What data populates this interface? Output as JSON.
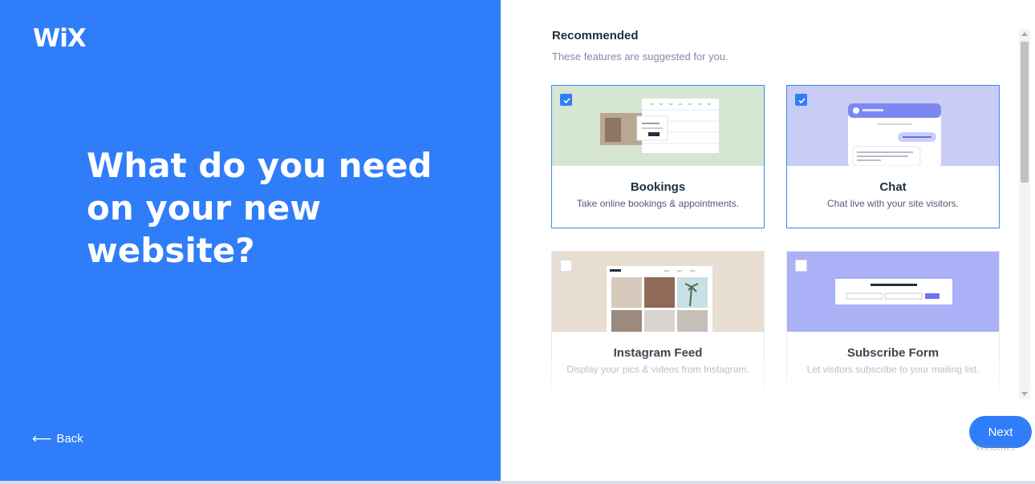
{
  "brand": {
    "logo_text": "WiX"
  },
  "headline": "What do you need on your new website?",
  "nav": {
    "back_label": "Back",
    "next_label": "Next"
  },
  "section": {
    "title": "Recommended",
    "subtitle": "These features are suggested for you."
  },
  "features": [
    {
      "title": "Bookings",
      "description": "Take online bookings & appointments.",
      "checked": true
    },
    {
      "title": "Chat",
      "description": "Chat live with your site visitors.",
      "checked": true
    },
    {
      "title": "Instagram Feed",
      "description": "Display your pics & videos from Instagram.",
      "checked": false
    },
    {
      "title": "Subscribe Form",
      "description": "Let visitors subscribe to your mailing list.",
      "checked": false
    }
  ],
  "watermark": "Windows",
  "colors": {
    "brand_blue": "#2f7df8",
    "bookings_thumb": "#d5e6d3",
    "chat_thumb": "#c9cdf5",
    "instagram_thumb": "#e8ddd1",
    "subscribe_thumb": "#aab1f7"
  }
}
